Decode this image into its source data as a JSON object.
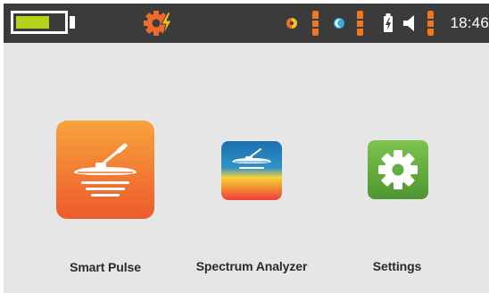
{
  "status_bar": {
    "battery_level": 0.72,
    "battery_color": "#b6d11b",
    "mode_icon": "gear-lightning-icon",
    "indicators": [
      {
        "icon": "sensitivity-icon",
        "level_color": "#f0761f"
      },
      {
        "icon": "discrimination-icon",
        "level_color": "#f0761f"
      },
      {
        "icon": "charging-battery-icon"
      },
      {
        "icon": "speaker-volume-icon",
        "level_color": "#f0761f"
      }
    ],
    "time": "18:46"
  },
  "apps": [
    {
      "label": "Smart Pulse",
      "icon": "detector-coil-icon",
      "colors": [
        "#f59a34",
        "#ef5d2e"
      ]
    },
    {
      "label": "Spectrum Analyzer",
      "icon": "spectrum-coil-icon",
      "colors": [
        "#1e79b4",
        "#f7d238",
        "#f06a33"
      ]
    },
    {
      "label": "Settings",
      "icon": "gear-icon",
      "colors": [
        "#75c04a",
        "#4f9a33"
      ]
    }
  ]
}
